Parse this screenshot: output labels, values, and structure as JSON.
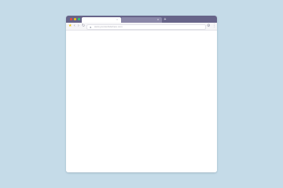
{
  "window": {
    "titlebar_color": "#676489",
    "traffic_lights": [
      "#e74c3c",
      "#f1c40f",
      "#2ecc71"
    ]
  },
  "tabs": [
    {
      "label": "",
      "active": true,
      "close_glyph": "×"
    },
    {
      "label": "",
      "active": false,
      "close_glyph": "×"
    }
  ],
  "new_tab_glyph": "+",
  "toolbar": {
    "bookmark_icon": "star-icon",
    "back_icon": "arrow-left-icon",
    "forward_icon": "arrow-right-icon",
    "reload_icon": "reload-icon",
    "address": {
      "url": "www.yourwebsitehere.com",
      "icon": "lock-icon"
    },
    "settings_icon": "settings-icon",
    "menu_icon": "menu-icon"
  }
}
